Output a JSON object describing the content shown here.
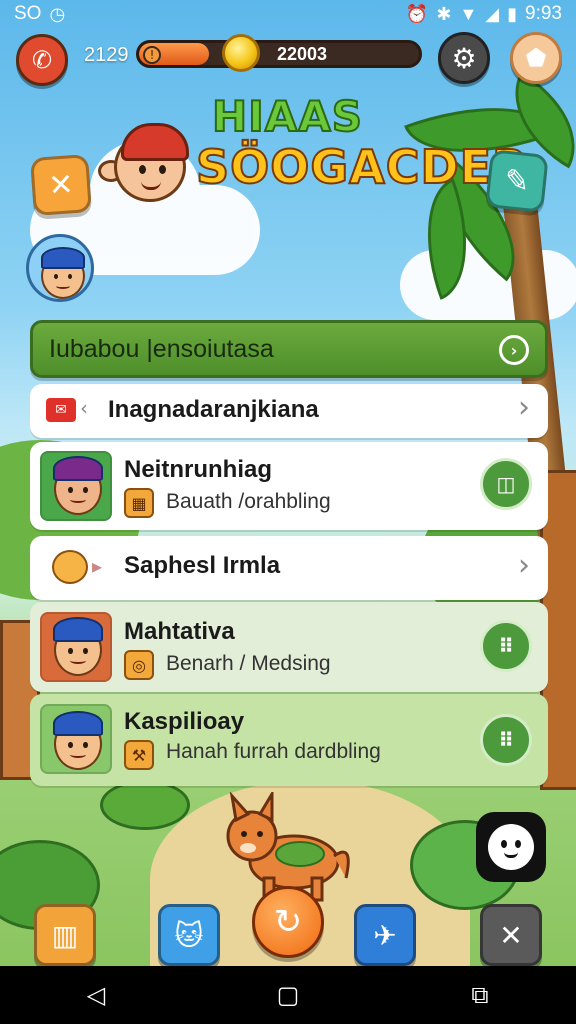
{
  "status_bar": {
    "left_text": "SO",
    "right_text": "9:93"
  },
  "hud": {
    "player_number": "2129",
    "energy": {
      "value_label": "22003",
      "fill_fraction": 0.25
    }
  },
  "title": {
    "line1": "HIAAS",
    "line2": "SÖOGACDER"
  },
  "list": {
    "header": "Iubabou |ensoiutasa",
    "rows": [
      {
        "title": "Inagnadaranjkiana"
      },
      {
        "title": "Neitnrunhiag",
        "subtitle": "Bauath /orahbling"
      },
      {
        "title": "Saphesl Irmla"
      },
      {
        "title": "Mahtativa",
        "subtitle": "Benarh / Medsing"
      },
      {
        "title": "Kaspilioay",
        "subtitle": "Hanah furrah dardbling"
      }
    ]
  },
  "colors": {
    "accent_green": "#4f8f2a",
    "energy_orange": "#e05a1a",
    "header_green": "#6aaa3e"
  },
  "icons": {
    "phone": "phone-icon",
    "coin": "coin-icon",
    "gear": "gear-icon",
    "badge": "badge-icon",
    "close": "close-icon",
    "edit": "pencil-icon",
    "map": "map-icon",
    "pet": "cat-icon",
    "main": "refresh-icon",
    "bird": "bird-icon",
    "tools": "tools-icon",
    "ghost": "ghost-icon"
  }
}
